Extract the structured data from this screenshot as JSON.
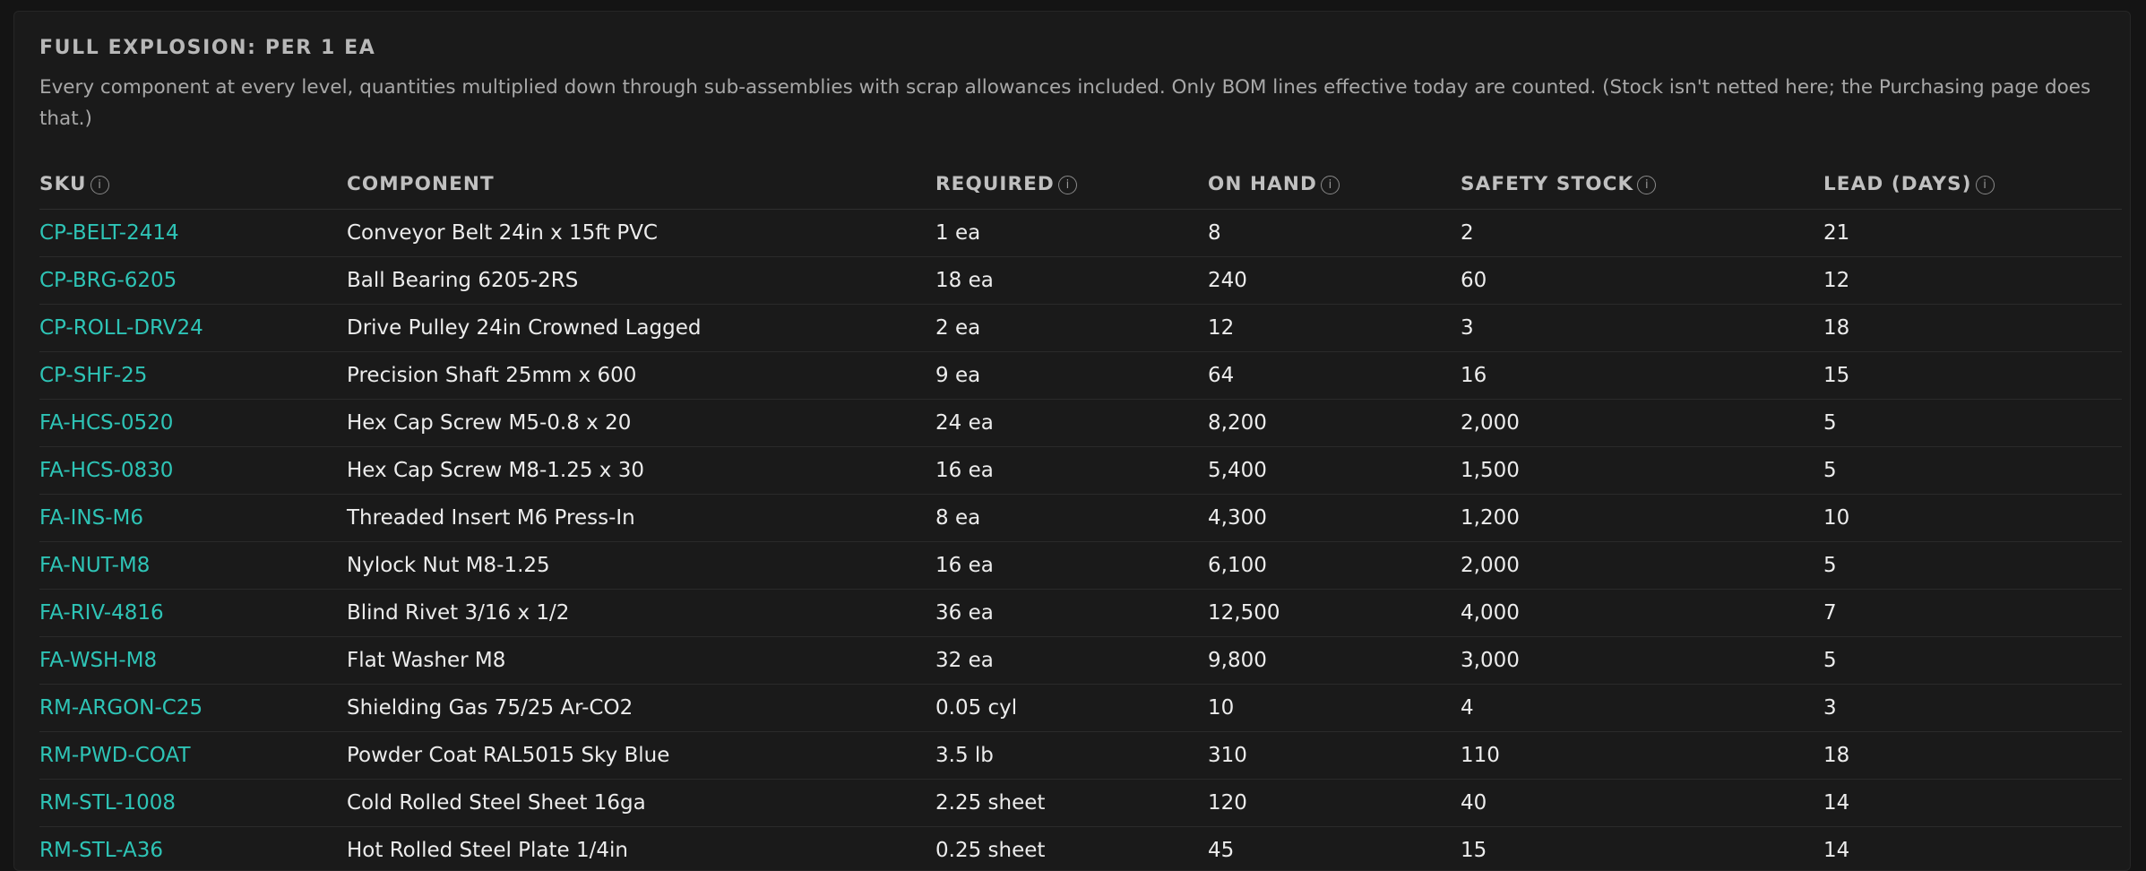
{
  "section": {
    "title": "FULL EXPLOSION: PER 1 EA",
    "description": "Every component at every level, quantities multiplied down through sub-assemblies with scrap allowances included. Only BOM lines effective today are counted. (Stock isn't netted here; the Purchasing page does that.)"
  },
  "table": {
    "columns": [
      {
        "label": "SKU",
        "info_icon": "info-icon"
      },
      {
        "label": "COMPONENT"
      },
      {
        "label": "REQUIRED",
        "info_icon": "info-icon"
      },
      {
        "label": "ON HAND",
        "info_icon": "info-icon"
      },
      {
        "label": "SAFETY STOCK",
        "info_icon": "info-icon"
      },
      {
        "label": "LEAD (DAYS)",
        "info_icon": "info-icon"
      }
    ],
    "info_glyph": "i",
    "link_color": "#2ec4b6",
    "rows": [
      {
        "sku": "CP-BELT-2414",
        "component": "Conveyor Belt 24in x 15ft PVC",
        "required": "1 ea",
        "on_hand": "8",
        "safety_stock": "2",
        "lead_days": "21"
      },
      {
        "sku": "CP-BRG-6205",
        "component": "Ball Bearing 6205-2RS",
        "required": "18 ea",
        "on_hand": "240",
        "safety_stock": "60",
        "lead_days": "12"
      },
      {
        "sku": "CP-ROLL-DRV24",
        "component": "Drive Pulley 24in Crowned Lagged",
        "required": "2 ea",
        "on_hand": "12",
        "safety_stock": "3",
        "lead_days": "18"
      },
      {
        "sku": "CP-SHF-25",
        "component": "Precision Shaft 25mm x 600",
        "required": "9 ea",
        "on_hand": "64",
        "safety_stock": "16",
        "lead_days": "15"
      },
      {
        "sku": "FA-HCS-0520",
        "component": "Hex Cap Screw M5-0.8 x 20",
        "required": "24 ea",
        "on_hand": "8,200",
        "safety_stock": "2,000",
        "lead_days": "5"
      },
      {
        "sku": "FA-HCS-0830",
        "component": "Hex Cap Screw M8-1.25 x 30",
        "required": "16 ea",
        "on_hand": "5,400",
        "safety_stock": "1,500",
        "lead_days": "5"
      },
      {
        "sku": "FA-INS-M6",
        "component": "Threaded Insert M6 Press-In",
        "required": "8 ea",
        "on_hand": "4,300",
        "safety_stock": "1,200",
        "lead_days": "10"
      },
      {
        "sku": "FA-NUT-M8",
        "component": "Nylock Nut M8-1.25",
        "required": "16 ea",
        "on_hand": "6,100",
        "safety_stock": "2,000",
        "lead_days": "5"
      },
      {
        "sku": "FA-RIV-4816",
        "component": "Blind Rivet 3/16 x 1/2",
        "required": "36 ea",
        "on_hand": "12,500",
        "safety_stock": "4,000",
        "lead_days": "7"
      },
      {
        "sku": "FA-WSH-M8",
        "component": "Flat Washer M8",
        "required": "32 ea",
        "on_hand": "9,800",
        "safety_stock": "3,000",
        "lead_days": "5"
      },
      {
        "sku": "RM-ARGON-C25",
        "component": "Shielding Gas 75/25 Ar-CO2",
        "required": "0.05 cyl",
        "on_hand": "10",
        "safety_stock": "4",
        "lead_days": "3"
      },
      {
        "sku": "RM-PWD-COAT",
        "component": "Powder Coat RAL5015 Sky Blue",
        "required": "3.5 lb",
        "on_hand": "310",
        "safety_stock": "110",
        "lead_days": "18"
      },
      {
        "sku": "RM-STL-1008",
        "component": "Cold Rolled Steel Sheet 16ga",
        "required": "2.25 sheet",
        "on_hand": "120",
        "safety_stock": "40",
        "lead_days": "14"
      },
      {
        "sku": "RM-STL-A36",
        "component": "Hot Rolled Steel Plate 1/4in",
        "required": "0.25 sheet",
        "on_hand": "45",
        "safety_stock": "15",
        "lead_days": "14"
      }
    ]
  }
}
